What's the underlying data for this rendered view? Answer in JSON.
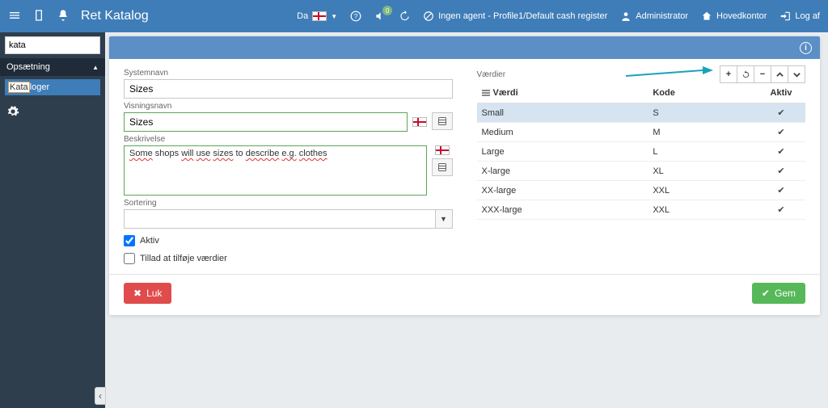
{
  "topbar": {
    "title": "Ret Katalog",
    "lang_label": "Da",
    "agent_text": "Ingen agent - Profile1/Default cash register",
    "admin": "Administrator",
    "hq": "Hovedkontor",
    "logout": "Log af"
  },
  "sidebar": {
    "search_value": "kata",
    "section": "Opsætning",
    "item_prefix": "Kata",
    "item_suffix": "loger"
  },
  "form": {
    "systemnavn_label": "Systemnavn",
    "systemnavn_value": "Sizes",
    "visningsnavn_label": "Visningsnavn",
    "visningsnavn_value": "Sizes",
    "beskrivelse_label": "Beskrivelse",
    "beskrivelse_value": "Some shops will use sizes to describe e.g. clothes",
    "sortering_label": "Sortering",
    "sortering_value": "",
    "aktiv_label": "Aktiv",
    "tillad_label": "Tillad at tilføje værdier"
  },
  "values_section": {
    "title": "Værdier",
    "col_value": "Værdi",
    "col_code": "Kode",
    "col_active": "Aktiv",
    "rows": [
      {
        "v": "Small",
        "k": "S"
      },
      {
        "v": "Medium",
        "k": "M"
      },
      {
        "v": "Large",
        "k": "L"
      },
      {
        "v": "X-large",
        "k": "XL"
      },
      {
        "v": "XX-large",
        "k": "XXL"
      },
      {
        "v": "XXX-large",
        "k": "XXL"
      }
    ]
  },
  "footer": {
    "close": "Luk",
    "save": "Gem"
  }
}
